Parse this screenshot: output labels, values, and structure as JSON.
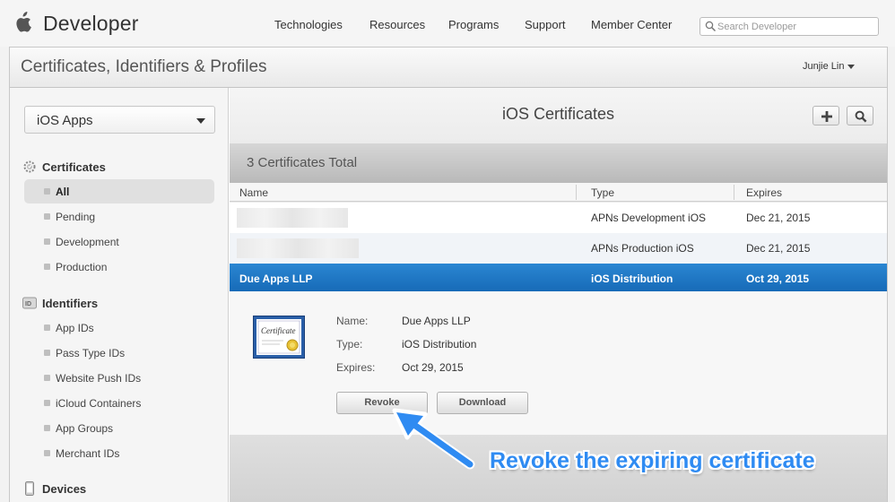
{
  "topnav": {
    "brand": "Developer",
    "links": [
      "Technologies",
      "Resources",
      "Programs",
      "Support",
      "Member Center"
    ],
    "search_placeholder": "Search Developer"
  },
  "panel": {
    "title": "Certificates, Identifiers & Profiles",
    "user": "Junjie Lin"
  },
  "sidebar": {
    "platform_select": "iOS Apps",
    "sections": [
      {
        "label": "Certificates",
        "icon": "certificate-gear-icon"
      },
      {
        "label": "Identifiers",
        "icon": "id-badge-icon"
      },
      {
        "label": "Devices",
        "icon": "iphone-icon"
      }
    ],
    "certificate_items": [
      "All",
      "Pending",
      "Development",
      "Production"
    ],
    "identifier_items": [
      "App IDs",
      "Pass Type IDs",
      "Website Push IDs",
      "iCloud Containers",
      "App Groups",
      "Merchant IDs"
    ]
  },
  "content": {
    "title": "iOS Certificates",
    "total": "3 Certificates Total",
    "columns": [
      "Name",
      "Type",
      "Expires"
    ],
    "rows": [
      {
        "name": "",
        "type": "APNs Development iOS",
        "expires": "Dec 21, 2015"
      },
      {
        "name": "",
        "type": "APNs Production iOS",
        "expires": "Dec 21, 2015"
      },
      {
        "name": "Due Apps LLP",
        "type": "iOS Distribution",
        "expires": "Oct 29, 2015"
      }
    ],
    "detail": {
      "name_label": "Name:",
      "name_value": "Due Apps LLP",
      "type_label": "Type:",
      "type_value": "iOS Distribution",
      "expires_label": "Expires:",
      "expires_value": "Oct 29, 2015",
      "revoke": "Revoke",
      "download": "Download",
      "cert_icon_text": "Certificate"
    }
  },
  "annotation": {
    "text": "Revoke the expiring certificate",
    "color": "#2f8bf2"
  },
  "colors": {
    "selected_row": "#1a72c0"
  }
}
